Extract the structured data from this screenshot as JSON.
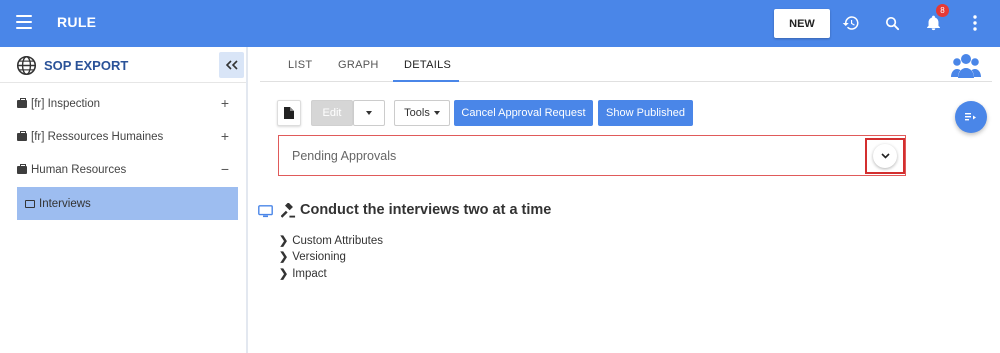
{
  "app": {
    "title": "RULE",
    "new_label": "NEW",
    "notification_count": "8",
    "accent": "#4a86e8"
  },
  "sidebar": {
    "title": "SOP EXPORT",
    "items": [
      {
        "label": "[fr] Inspection",
        "toggle": "+"
      },
      {
        "label": "[fr] Ressources Humaines",
        "toggle": "+"
      },
      {
        "label": "Human Resources",
        "toggle": "−"
      }
    ],
    "selected": {
      "label": "Interviews"
    }
  },
  "tabs": [
    {
      "label": "LIST"
    },
    {
      "label": "GRAPH"
    },
    {
      "label": "DETAILS"
    }
  ],
  "toolbar": {
    "edit_label": "Edit",
    "tools_label": "Tools",
    "cancel_label": "Cancel Approval Request",
    "show_label": "Show Published"
  },
  "pending": {
    "label": "Pending Approvals"
  },
  "rule": {
    "title": "Conduct the interviews two at a time"
  },
  "sections": [
    {
      "label": "Custom Attributes"
    },
    {
      "label": "Versioning"
    },
    {
      "label": "Impact"
    }
  ]
}
